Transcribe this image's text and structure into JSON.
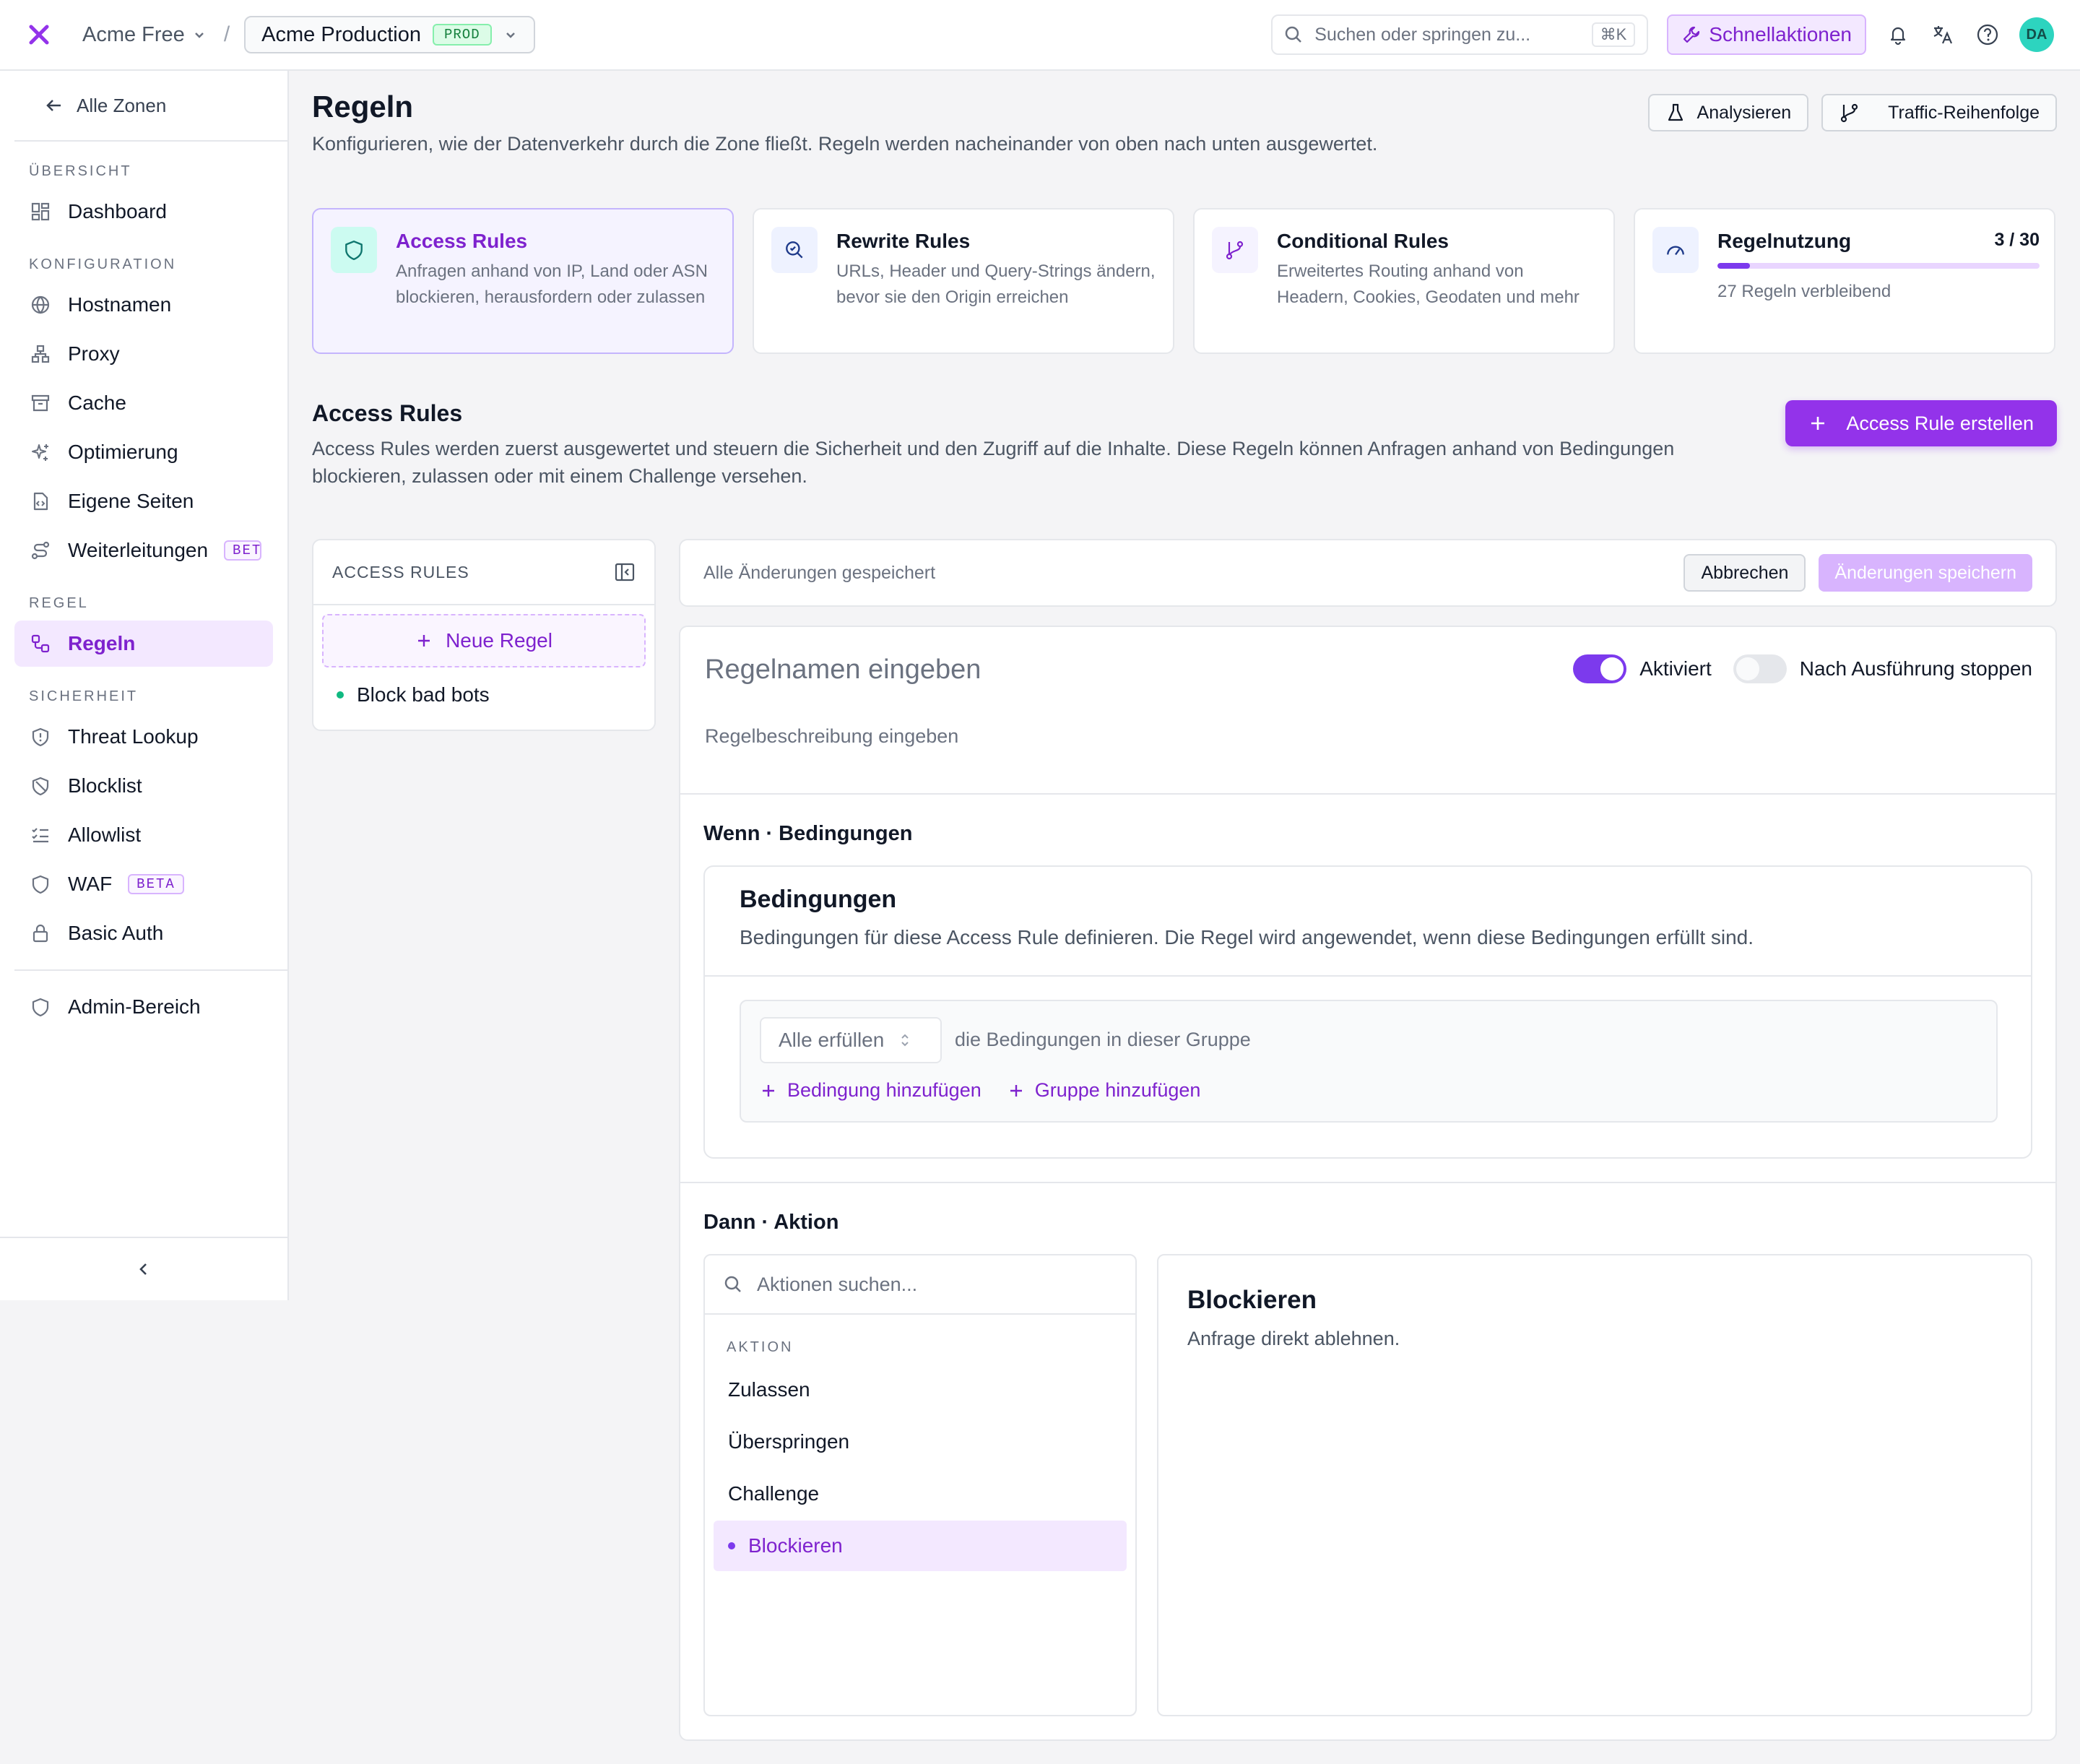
{
  "topbar": {
    "org": "Acme Free",
    "separator": "/",
    "zone": "Acme Production",
    "zone_badge": "PROD",
    "search_placeholder": "Suchen oder springen zu...",
    "search_shortcut": "⌘K",
    "quick_actions": "Schnellaktionen",
    "avatar": "DA"
  },
  "sidebar": {
    "back": "Alle Zonen",
    "sections": {
      "overview": "ÜBERSICHT",
      "config": "KONFIGURATION",
      "rules": "REGEL",
      "security": "SICHERHEIT"
    },
    "items": {
      "dashboard": "Dashboard",
      "hostnames": "Hostnamen",
      "proxy": "Proxy",
      "cache": "Cache",
      "optimization": "Optimierung",
      "custom_pages": "Eigene Seiten",
      "redirects": "Weiterleitungen",
      "redirects_badge": "BETA",
      "rules": "Regeln",
      "threat_lookup": "Threat Lookup",
      "blocklist": "Blocklist",
      "allowlist": "Allowlist",
      "waf": "WAF",
      "waf_badge": "BETA",
      "basic_auth": "Basic Auth",
      "admin": "Admin-Bereich"
    }
  },
  "page": {
    "title": "Regeln",
    "subtitle": "Konfigurieren, wie der Datenverkehr durch die Zone fließt. Regeln werden nacheinander von oben nach unten ausgewertet.",
    "analyze": "Analysieren",
    "traffic_order": "Traffic-Reihenfolge"
  },
  "cards": {
    "access": {
      "title": "Access Rules",
      "desc": "Anfragen anhand von IP, Land oder ASN blockieren, herausfordern oder zulassen"
    },
    "rewrite": {
      "title": "Rewrite Rules",
      "desc": "URLs, Header und Query-Strings ändern, bevor sie den Origin erreichen"
    },
    "conditional": {
      "title": "Conditional Rules",
      "desc": "Erweitertes Routing anhand von Headern, Cookies, Geodaten und mehr"
    },
    "usage": {
      "title": "Regelnutzung",
      "count": "3 / 30",
      "used": 3,
      "total": 30,
      "remaining": "27 Regeln verbleibend"
    }
  },
  "access_rules": {
    "title": "Access Rules",
    "desc": "Access Rules werden zuerst ausgewertet und steuern die Sicherheit und den Zugriff auf die Inhalte. Diese Regeln können Anfragen anhand von Bedingungen blockieren, zulassen oder mit einem Challenge versehen.",
    "create": "Access Rule erstellen",
    "list_header": "ACCESS RULES",
    "new_rule": "Neue Regel",
    "rules": [
      "Block bad bots"
    ]
  },
  "save_bar": {
    "status": "Alle Änderungen gespeichert",
    "cancel": "Abbrechen",
    "save": "Änderungen speichern"
  },
  "editor": {
    "name_placeholder": "Regelnamen eingeben",
    "enabled_label": "Aktiviert",
    "stop_label": "Nach Ausführung stoppen",
    "desc_placeholder": "Regelbeschreibung eingeben",
    "when_title": "Wenn · Bedingungen",
    "cond_title": "Bedingungen",
    "cond_desc": "Bedingungen für diese Access Rule definieren. Die Regel wird angewendet, wenn diese Bedingungen erfüllt sind.",
    "match_value": "Alle erfüllen",
    "match_text": "die Bedingungen in dieser Gruppe",
    "add_condition": "Bedingung hinzufügen",
    "add_group": "Gruppe hinzufügen",
    "then_title": "Dann · Aktion",
    "action_search": "Aktionen suchen...",
    "action_section": "AKTION",
    "actions": [
      "Zulassen",
      "Überspringen",
      "Challenge",
      "Blockieren"
    ],
    "selected_action": "Blockieren",
    "selected_desc": "Anfrage direkt ablehnen."
  },
  "colors": {
    "accent": "#9333ea",
    "accent_light": "#f3e8ff",
    "success": "#10b981"
  }
}
